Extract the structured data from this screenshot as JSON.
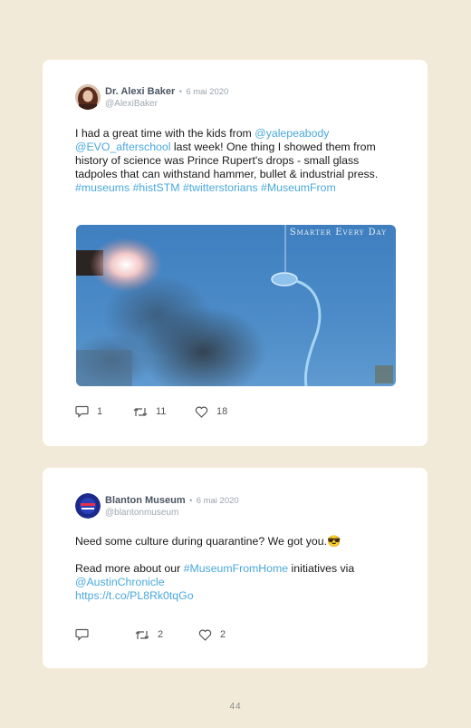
{
  "tweets": [
    {
      "author": "Dr. Alexi Baker",
      "separator": "•",
      "date": "6 mai 2020",
      "handle": "@AlexiBaker",
      "body": [
        {
          "t": "I had a great time with the kids from "
        },
        {
          "t": "@yalepeabody",
          "link": true
        },
        {
          "t": " "
        },
        {
          "t": "@EVO_afterschool",
          "link": true
        },
        {
          "t": " last week! One thing I showed them from history of science was Prince Rupert's drops - small glass tadpoles that can withstand hammer, bullet & industrial press. "
        },
        {
          "t": "#museums",
          "link": true
        },
        {
          "t": " "
        },
        {
          "t": "#histSTM",
          "link": true
        },
        {
          "t": " "
        },
        {
          "t": "#twitterstorians",
          "link": true
        },
        {
          "t": " "
        },
        {
          "t": "#MuseumFrom",
          "link": true
        }
      ],
      "media_watermark": "Smarter Every Day",
      "replies": "1",
      "retweets": "11",
      "likes": "18"
    },
    {
      "author": "Blanton Museum",
      "separator": "•",
      "date": "6 mai 2020",
      "handle": "@blantonmuseum",
      "body_line1": "Need some culture during quarantine? We got you.",
      "emoji": "😎",
      "body2": [
        {
          "t": "Read more about our "
        },
        {
          "t": "#MuseumFromHome",
          "link": true
        },
        {
          "t": " initiatives via "
        },
        {
          "t": "@AustinChronicle",
          "link": true,
          "br_before": true
        },
        {
          "t": "https://t.co/PL8Rk0tqGo",
          "link": true,
          "br_before": true
        }
      ],
      "replies": "",
      "retweets": "2",
      "likes": "2"
    }
  ],
  "page_number": "44",
  "colors": {
    "link": "#4aa8dd",
    "background": "#f1ead9",
    "card": "#ffffff"
  }
}
